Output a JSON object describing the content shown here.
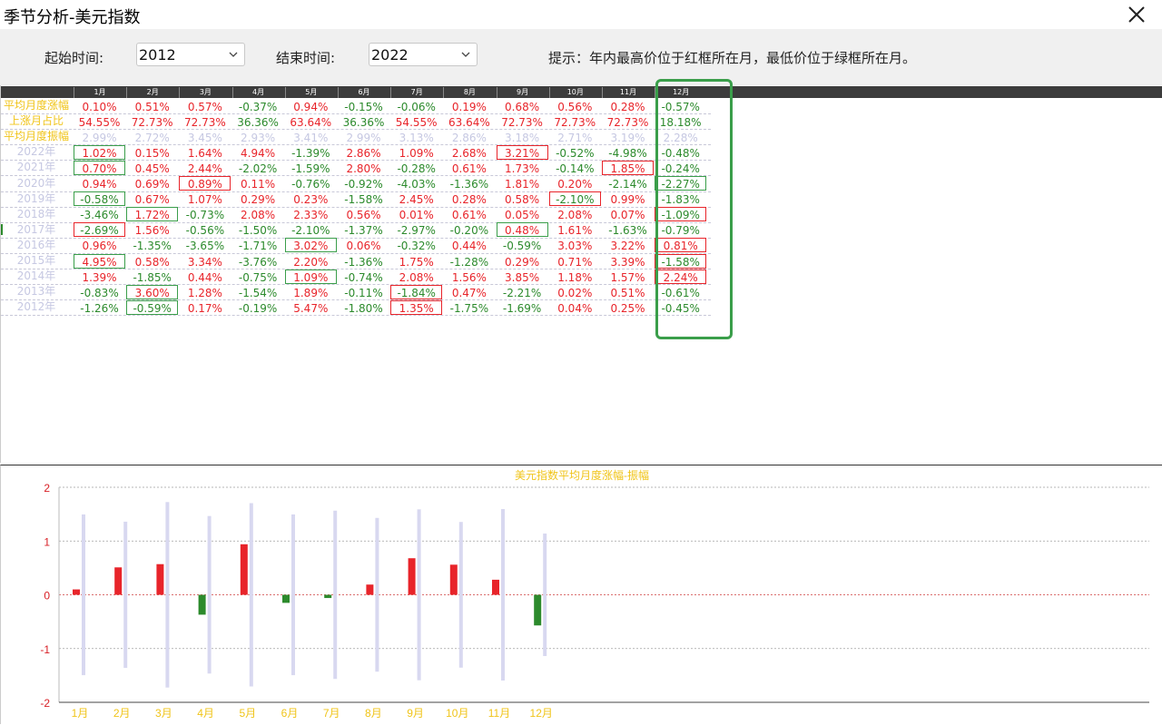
{
  "window": {
    "title": "季节分析-美元指数"
  },
  "toolbar": {
    "start_label": "起始时间:",
    "start_value": "2012",
    "end_label": "结束时间:",
    "end_value": "2022",
    "hint": "提示：年内最高价位于红框所在月，最低价位于绿框所在月。"
  },
  "table": {
    "months": [
      "1月",
      "2月",
      "3月",
      "4月",
      "5月",
      "6月",
      "7月",
      "8月",
      "9月",
      "10月",
      "11月",
      "12月"
    ],
    "summary": [
      {
        "label": "平均月度涨幅",
        "values": [
          "0.10%",
          "0.51%",
          "0.57%",
          "-0.37%",
          "0.94%",
          "-0.15%",
          "-0.06%",
          "0.19%",
          "0.68%",
          "0.56%",
          "0.28%",
          "-0.57%"
        ]
      },
      {
        "label": "上涨月占比",
        "values": [
          "54.55%",
          "72.73%",
          "72.73%",
          "36.36%",
          "63.64%",
          "36.36%",
          "54.55%",
          "63.64%",
          "72.73%",
          "72.73%",
          "72.73%",
          "18.18%"
        ]
      },
      {
        "label": "平均月度振幅",
        "values": [
          "2.99%",
          "2.72%",
          "3.45%",
          "2.93%",
          "3.41%",
          "2.99%",
          "3.13%",
          "2.86%",
          "3.18%",
          "2.71%",
          "3.19%",
          "2.28%"
        ]
      }
    ],
    "years": [
      {
        "label": "2022年",
        "values": [
          "1.02%",
          "0.15%",
          "1.64%",
          "4.94%",
          "-1.39%",
          "2.86%",
          "1.09%",
          "2.68%",
          "3.21%",
          "-0.52%",
          "-4.98%",
          "-0.48%"
        ],
        "red_box": 8,
        "green_box": 0
      },
      {
        "label": "2021年",
        "values": [
          "0.70%",
          "0.45%",
          "2.44%",
          "-2.02%",
          "-1.59%",
          "2.80%",
          "-0.28%",
          "0.61%",
          "1.73%",
          "-0.14%",
          "1.85%",
          "-0.24%"
        ],
        "red_box": 10,
        "green_box": 0
      },
      {
        "label": "2020年",
        "values": [
          "0.94%",
          "0.69%",
          "0.89%",
          "0.11%",
          "-0.76%",
          "-0.92%",
          "-4.03%",
          "-1.36%",
          "1.81%",
          "0.20%",
          "-2.14%",
          "-2.27%"
        ],
        "red_box": 2,
        "green_box": 11
      },
      {
        "label": "2019年",
        "values": [
          "-0.58%",
          "0.67%",
          "1.07%",
          "0.29%",
          "0.23%",
          "-1.58%",
          "2.45%",
          "0.28%",
          "0.58%",
          "-2.10%",
          "0.99%",
          "-1.83%"
        ],
        "red_box": 9,
        "green_box": 0
      },
      {
        "label": "2018年",
        "values": [
          "-3.46%",
          "1.72%",
          "-0.73%",
          "2.08%",
          "2.33%",
          "0.56%",
          "0.01%",
          "0.61%",
          "0.05%",
          "2.08%",
          "0.07%",
          "-1.09%"
        ],
        "red_box": 11,
        "green_box": 1
      },
      {
        "label": "2017年",
        "values": [
          "-2.69%",
          "1.56%",
          "-0.56%",
          "-1.50%",
          "-2.10%",
          "-1.37%",
          "-2.97%",
          "-0.20%",
          "0.48%",
          "1.61%",
          "-1.63%",
          "-0.79%"
        ],
        "red_box": 0,
        "green_box": 8
      },
      {
        "label": "2016年",
        "values": [
          "0.96%",
          "-1.35%",
          "-3.65%",
          "-1.71%",
          "3.02%",
          "0.06%",
          "-0.32%",
          "0.44%",
          "-0.59%",
          "3.03%",
          "3.22%",
          "0.81%"
        ],
        "red_box": 11,
        "green_box": 4
      },
      {
        "label": "2015年",
        "values": [
          "4.95%",
          "0.58%",
          "3.34%",
          "-3.76%",
          "2.20%",
          "-1.36%",
          "1.75%",
          "-1.28%",
          "0.29%",
          "0.71%",
          "3.39%",
          "-1.58%"
        ],
        "red_box": 11,
        "green_box": 0
      },
      {
        "label": "2014年",
        "values": [
          "1.39%",
          "-1.85%",
          "0.44%",
          "-0.75%",
          "1.09%",
          "-0.74%",
          "2.08%",
          "1.56%",
          "3.85%",
          "1.18%",
          "1.57%",
          "2.24%"
        ],
        "red_box": 11,
        "green_box": 4
      },
      {
        "label": "2013年",
        "values": [
          "-0.83%",
          "3.60%",
          "1.28%",
          "-1.54%",
          "1.89%",
          "-0.11%",
          "-1.84%",
          "0.47%",
          "-2.21%",
          "0.02%",
          "0.51%",
          "-0.61%"
        ],
        "red_box": 6,
        "green_box": 1
      },
      {
        "label": "2012年",
        "values": [
          "-1.26%",
          "-0.59%",
          "0.17%",
          "-0.19%",
          "5.47%",
          "-1.80%",
          "1.35%",
          "-1.75%",
          "-1.69%",
          "0.04%",
          "0.25%",
          "-0.45%"
        ],
        "red_box": 6,
        "green_box": 1
      }
    ]
  },
  "colors": {
    "up": "#e8242a",
    "down": "#2c8a2c",
    "label_gold": "#f0c419",
    "label_muted": "#c6c8e2",
    "box_red": "#e8242a",
    "box_green": "#3a9e4a",
    "amplitude_bar": "#d8d8f0"
  },
  "chart_data": {
    "type": "bar",
    "title": "美元指数平均月度涨幅-振幅",
    "categories": [
      "1月",
      "2月",
      "3月",
      "4月",
      "5月",
      "6月",
      "7月",
      "8月",
      "9月",
      "10月",
      "11月",
      "12月"
    ],
    "ylim": [
      -2,
      2
    ],
    "yticks": [
      "2",
      "1",
      "0",
      "-1",
      "-2"
    ],
    "series": [
      {
        "values": [
          0.1,
          0.51,
          0.57,
          -0.37,
          0.94,
          -0.15,
          -0.06,
          0.19,
          0.68,
          0.56,
          0.28,
          -0.57
        ]
      },
      {
        "values": [
          2.99,
          2.72,
          3.45,
          2.93,
          3.41,
          2.99,
          3.13,
          2.86,
          3.18,
          2.71,
          3.19,
          2.28
        ]
      }
    ]
  }
}
